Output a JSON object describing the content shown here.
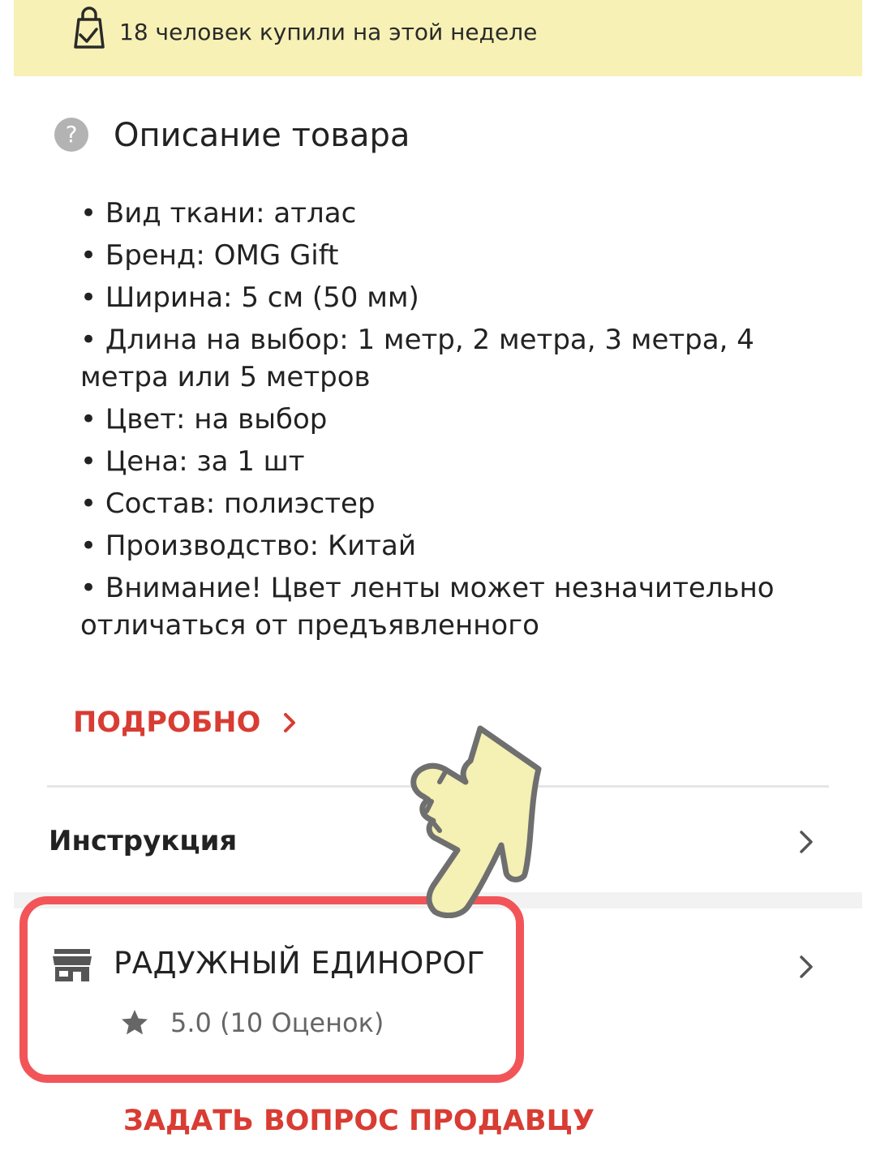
{
  "banner": {
    "text": "18 человек купили на этой неделе",
    "icon": "shopping-bag-check-icon"
  },
  "description": {
    "help_icon": "?",
    "title": "Описание товара",
    "items": [
      "• Вид ткани: атлас",
      "• Бренд: OMG Gift",
      "• Ширина: 5 см (50 мм)",
      "• Длина на выбор: 1 метр, 2 метра, 3 метра, 4 метра или 5 метров",
      "• Цвет: на выбор",
      "• Цена: за 1 шт",
      "• Состав: полиэстер",
      "• Производство: Китай",
      "• Внимание! Цвет  ленты может незначительно отличаться от предъявленного"
    ],
    "more_label": "ПОДРОБНО"
  },
  "instruction": {
    "label": "Инструкция"
  },
  "store": {
    "name": "РАДУЖНЫЙ ЕДИНОРОГ",
    "rating": "5.0 (10 Оценок)",
    "icon": "store-icon"
  },
  "ask_seller": {
    "label": "ЗАДАТЬ ВОПРОС ПРОДАВЦУ"
  },
  "colors": {
    "banner_bg": "#f7f1b5",
    "accent_red": "#d83c33",
    "highlight": "#f25558",
    "hand_fill": "#f5f0b3"
  }
}
